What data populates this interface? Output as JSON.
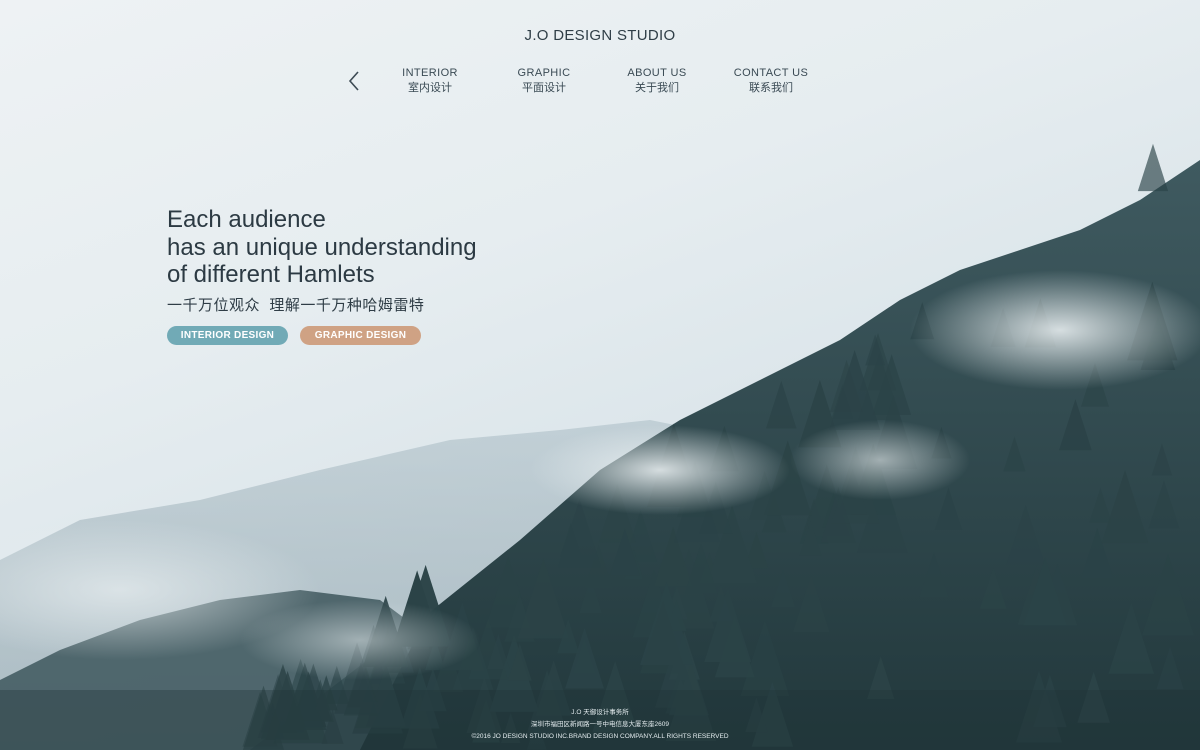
{
  "brand": {
    "title": "J.O DESIGN STUDIO"
  },
  "nav": {
    "back_icon": "chevron-left-icon",
    "items": [
      {
        "en": "INTERIOR",
        "zh": "室内设计"
      },
      {
        "en": "GRAPHIC",
        "zh": "平面设计"
      },
      {
        "en": "ABOUT US",
        "zh": "关于我们"
      },
      {
        "en": "CONTACT US",
        "zh": "联系我们"
      }
    ]
  },
  "hero": {
    "line1": "Each audience",
    "line2": "has an unique understanding",
    "line3": "of different Hamlets",
    "subtitle": "一千万位观众  理解一千万种哈姆雷特"
  },
  "tags": {
    "interior": {
      "label": "INTERIOR DESIGN",
      "color": "#71aab6"
    },
    "graphic": {
      "label": "GRAPHIC DESIGN",
      "color": "#cfa284"
    }
  },
  "footer": {
    "line1": "J.O 天御设计事务所",
    "line2": "深圳市福田区新闻路一号中电信息大厦东座2609",
    "line3": "©2016 JO DESIGN STUDIO INC.BRAND DESIGN COMPANY.ALL RIGHTS RESERVED"
  },
  "background": {
    "subject": "misty-pine-forest-hillside"
  }
}
